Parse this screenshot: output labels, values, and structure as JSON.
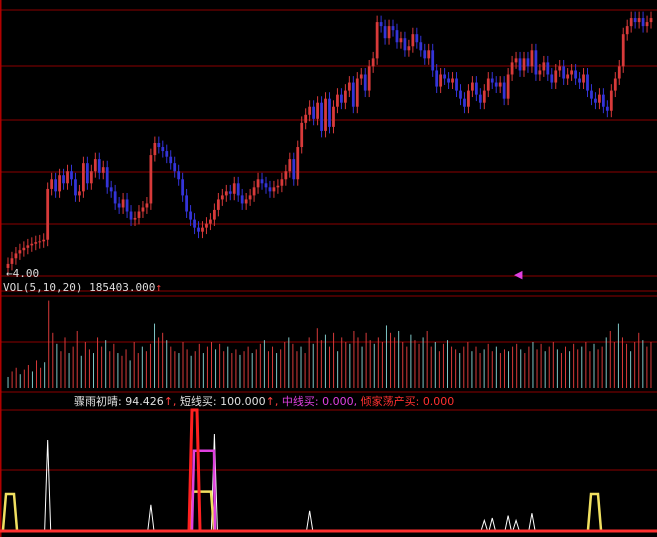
{
  "colors": {
    "background": "#000000",
    "grid": "#8b0000",
    "up": "#d83a3a",
    "down": "#3434d8",
    "vol_down": "#7fc6c6",
    "label_text": "#dcdcdc",
    "indicator_main": "#ffffff",
    "short_buy": "#ff2020",
    "mid_buy": "#e040e0",
    "bankrupt_buy": "#ff3030",
    "signal_yellow": "#f0e060"
  },
  "price_panel": {
    "low_marker": "←4.00",
    "marker_icon": "left-triangle-marker"
  },
  "volume_panel": {
    "name": "VOL(5,10,20)",
    "value": "185403.000",
    "arrow": "↑"
  },
  "indicator_panel": {
    "name": "骤雨初晴:",
    "value": "94.426",
    "arrow1": "↑,",
    "short_label": "短线买:",
    "short_value": "100.000",
    "arrow2": "↑,",
    "mid_label": "中线买:",
    "mid_value": "0.000,",
    "bankrupt_label": "倾家荡产买:",
    "bankrupt_value": "0.000"
  },
  "chart_data": [
    {
      "type": "candlestick",
      "description_ylim": [
        3.9,
        7.2
      ],
      "ylim": [
        3.9,
        7.2
      ],
      "series_closes": [
        4.05,
        4.12,
        4.18,
        4.22,
        4.25,
        4.28,
        4.3,
        4.32,
        4.33,
        4.35,
        4.98,
        5.1,
        4.95,
        5.15,
        5.05,
        5.2,
        5.1,
        4.9,
        4.95,
        5.3,
        5.05,
        5.2,
        5.35,
        5.18,
        5.25,
        5.0,
        4.95,
        4.8,
        4.75,
        4.85,
        4.7,
        4.6,
        4.62,
        4.7,
        4.75,
        4.8,
        5.4,
        5.55,
        5.5,
        5.45,
        5.38,
        5.3,
        5.2,
        5.1,
        4.9,
        4.7,
        4.6,
        4.5,
        4.45,
        4.5,
        4.55,
        4.6,
        4.72,
        4.85,
        4.9,
        4.95,
        4.92,
        5.05,
        4.9,
        4.8,
        4.85,
        4.9,
        5.0,
        5.1,
        5.05,
        5.0,
        4.95,
        5.0,
        5.02,
        5.1,
        5.2,
        5.35,
        5.1,
        5.5,
        5.8,
        5.9,
        6.0,
        5.85,
        6.05,
        5.7,
        6.1,
        5.75,
        6.0,
        6.15,
        6.05,
        6.2,
        6.3,
        6.0,
        6.35,
        6.4,
        6.2,
        6.5,
        6.6,
        7.05,
        7.0,
        6.85,
        7.0,
        6.95,
        6.8,
        6.85,
        6.7,
        6.75,
        6.9,
        6.8,
        6.7,
        6.6,
        6.7,
        6.45,
        6.25,
        6.4,
        6.35,
        6.3,
        6.35,
        6.2,
        6.1,
        6.0,
        6.2,
        6.3,
        6.15,
        6.05,
        6.2,
        6.35,
        6.3,
        6.25,
        6.3,
        6.1,
        6.4,
        6.55,
        6.6,
        6.45,
        6.6,
        6.5,
        6.7,
        6.4,
        6.45,
        6.55,
        6.4,
        6.3,
        6.45,
        6.5,
        6.35,
        6.4,
        6.45,
        6.35,
        6.3,
        6.4,
        6.2,
        6.1,
        6.05,
        6.15,
        6.0,
        5.95,
        6.2,
        6.35,
        6.5,
        6.9,
        7.0,
        7.1,
        7.05,
        7.1,
        7.0,
        7.05,
        7.1
      ]
    },
    {
      "type": "bar",
      "name": "VOL",
      "value": 185403.0,
      "values": [
        12,
        18,
        22,
        15,
        20,
        25,
        18,
        30,
        22,
        28,
        95,
        60,
        48,
        40,
        55,
        38,
        45,
        62,
        35,
        50,
        42,
        38,
        55,
        45,
        52,
        40,
        48,
        38,
        35,
        42,
        30,
        50,
        38,
        45,
        40,
        48,
        70,
        55,
        60,
        52,
        45,
        40,
        38,
        50,
        42,
        35,
        40,
        48,
        38,
        45,
        50,
        42,
        48,
        40,
        45,
        38,
        42,
        36,
        40,
        45,
        38,
        42,
        48,
        52,
        40,
        45,
        38,
        42,
        50,
        55,
        48,
        40,
        45,
        38,
        55,
        48,
        65,
        52,
        58,
        45,
        60,
        40,
        55,
        50,
        48,
        62,
        55,
        45,
        60,
        52,
        48,
        55,
        50,
        68,
        60,
        55,
        62,
        50,
        45,
        58,
        52,
        48,
        55,
        62,
        45,
        50,
        40,
        48,
        52,
        45,
        42,
        38,
        45,
        50,
        40,
        45,
        38,
        42,
        48,
        40,
        45,
        38,
        42,
        40,
        45,
        48,
        42,
        38,
        45,
        50,
        42,
        48,
        40,
        45,
        50,
        42,
        38,
        45,
        40,
        48,
        42,
        45,
        50,
        40,
        48,
        42,
        45,
        55,
        62,
        50,
        70,
        55,
        48,
        40,
        50,
        60,
        52,
        45,
        50
      ]
    },
    {
      "type": "line",
      "name": "骤雨初晴",
      "value": 94.426,
      "ylim": [
        0,
        100
      ],
      "series": [
        {
          "name": "骤雨初晴",
          "spikes": [
            [
              10,
              75
            ],
            [
              36,
              21
            ],
            [
              52,
              80
            ],
            [
              76,
              16
            ],
            [
              94,
              0
            ],
            [
              120,
              8
            ],
            [
              122,
              10
            ],
            [
              126,
              12
            ],
            [
              128,
              8
            ],
            [
              132,
              14
            ]
          ]
        },
        {
          "name": "短线买",
          "value": 100.0
        },
        {
          "name": "中线买",
          "value": 0.0
        },
        {
          "name": "倾家荡产买",
          "value": 0.0
        }
      ]
    }
  ]
}
